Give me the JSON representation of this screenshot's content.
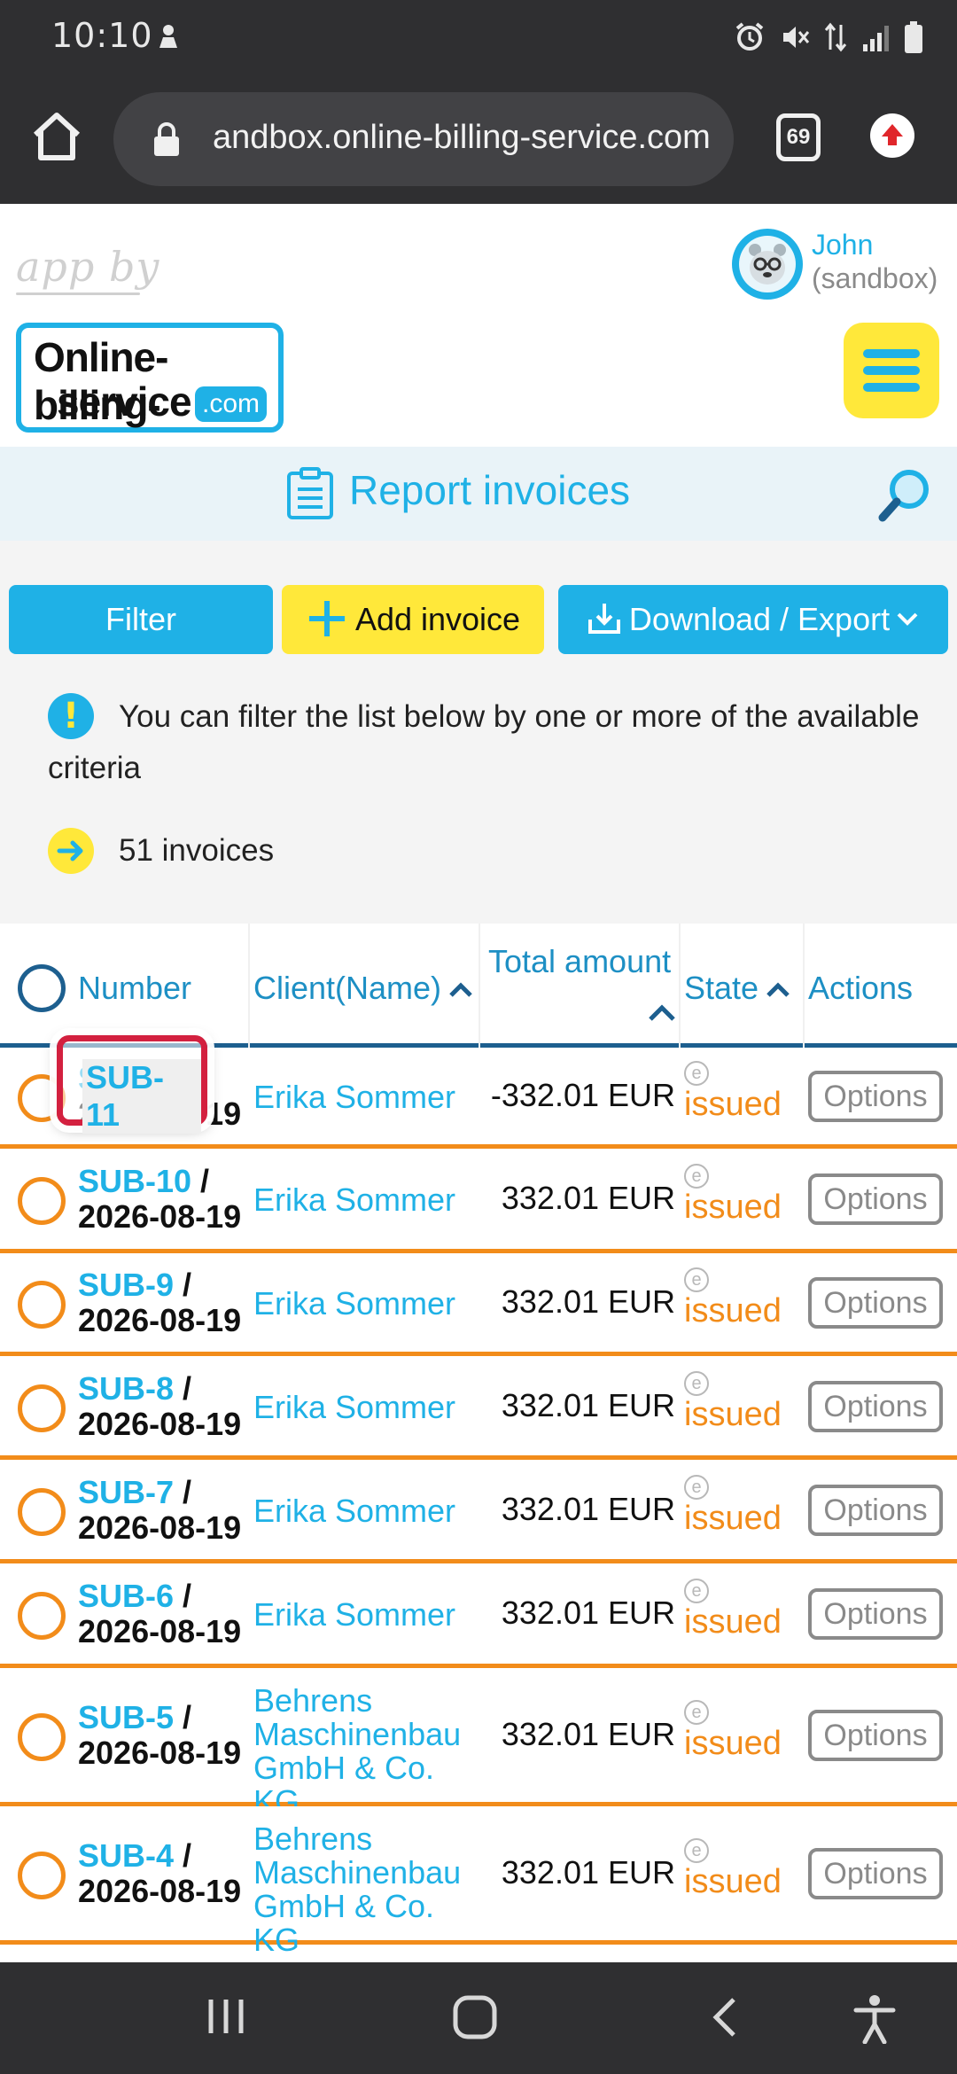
{
  "status_bar": {
    "time": "10:10"
  },
  "browser": {
    "url": "andbox.online-billing-service.com",
    "tab_count": "69"
  },
  "header": {
    "app_by": "app by",
    "logo_line1": "Online-billing-",
    "logo_line2": "service",
    "logo_com": ".com",
    "user_name": "John",
    "user_sub": "(sandbox)"
  },
  "page": {
    "title": "Report invoices"
  },
  "toolbar": {
    "filter_label": "Filter",
    "add_label": "Add invoice",
    "export_label": "Download / Export"
  },
  "info": {
    "filter_hint": "You can filter the list below by one or more of the available criteria",
    "count_text": "51 invoices"
  },
  "table": {
    "columns": {
      "number": "Number",
      "client": "Client(Name)",
      "total": "Total amount",
      "state": "State",
      "actions": "Actions"
    },
    "state_marker": "e",
    "options_label": "Options",
    "rows": [
      {
        "number": "SUB-11",
        "date": "2026-08-19",
        "client": "Erika Sommer",
        "amount": "-332.01 EUR",
        "state": "issued"
      },
      {
        "number": "SUB-10",
        "date": "2026-08-19",
        "client": "Erika Sommer",
        "amount": "332.01 EUR",
        "state": "issued"
      },
      {
        "number": "SUB-9",
        "date": "2026-08-19",
        "client": "Erika Sommer",
        "amount": "332.01 EUR",
        "state": "issued"
      },
      {
        "number": "SUB-8",
        "date": "2026-08-19",
        "client": "Erika Sommer",
        "amount": "332.01 EUR",
        "state": "issued"
      },
      {
        "number": "SUB-7",
        "date": "2026-08-19",
        "client": "Erika Sommer",
        "amount": "332.01 EUR",
        "state": "issued"
      },
      {
        "number": "SUB-6",
        "date": "2026-08-19",
        "client": "Erika Sommer",
        "amount": "332.01 EUR",
        "state": "issued"
      },
      {
        "number": "SUB-5",
        "date": "2026-08-19",
        "client": "Behrens Maschinenbau GmbH & Co. KG",
        "amount": "332.01 EUR",
        "state": "issued"
      },
      {
        "number": "SUB-4",
        "date": "2026-08-19",
        "client": "Behrens Maschinenbau GmbH & Co. KG",
        "amount": "332.01 EUR",
        "state": "issued"
      }
    ]
  },
  "highlight": {
    "label": "SUB-11"
  },
  "colors": {
    "brand_blue": "#1fb1e6",
    "brand_yellow": "#ffe83a",
    "issued_orange": "#f28c1a",
    "header_navy": "#1d5f8f",
    "highlight_red": "#d3203f"
  }
}
